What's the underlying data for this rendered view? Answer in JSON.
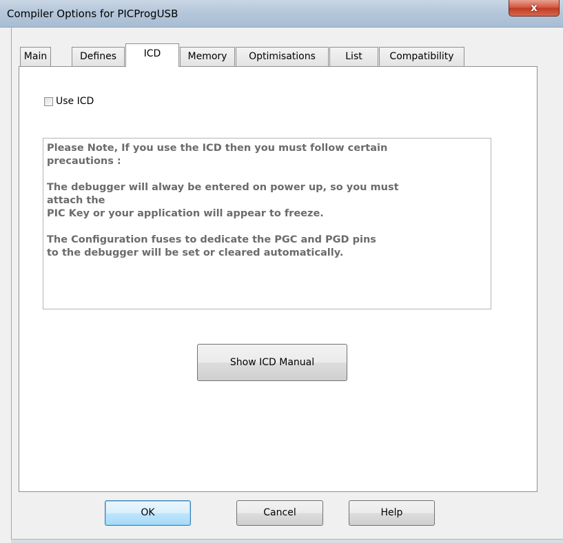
{
  "window": {
    "title": "Compiler Options for PICProgUSB",
    "close_glyph": "x"
  },
  "tabs": [
    {
      "label": "Main",
      "active": false
    },
    {
      "label": "Defines",
      "active": false
    },
    {
      "label": "ICD",
      "active": true
    },
    {
      "label": "Memory",
      "active": false
    },
    {
      "label": "Optimisations",
      "active": false
    },
    {
      "label": "List",
      "active": false
    },
    {
      "label": "Compatibility",
      "active": false
    }
  ],
  "icd_panel": {
    "use_icd_label": "Use ICD",
    "use_icd_checked": false,
    "note_text": "Please Note, If you use the ICD then you must follow certain\nprecautions :\n\nThe debugger will alway be entered on power up, so you must\nattach the\nPIC Key or your application will appear to freeze.\n\nThe Configuration fuses to dedicate the PGC and PGD pins\nto the debugger will be set or cleared automatically.",
    "manual_button": "Show ICD Manual"
  },
  "footer": {
    "ok": "OK",
    "cancel": "Cancel",
    "help": "Help"
  },
  "colors": {
    "note_text": "#6b6b6b",
    "close_button": "#c9452d",
    "ok_button_border": "#3c7fb1"
  }
}
